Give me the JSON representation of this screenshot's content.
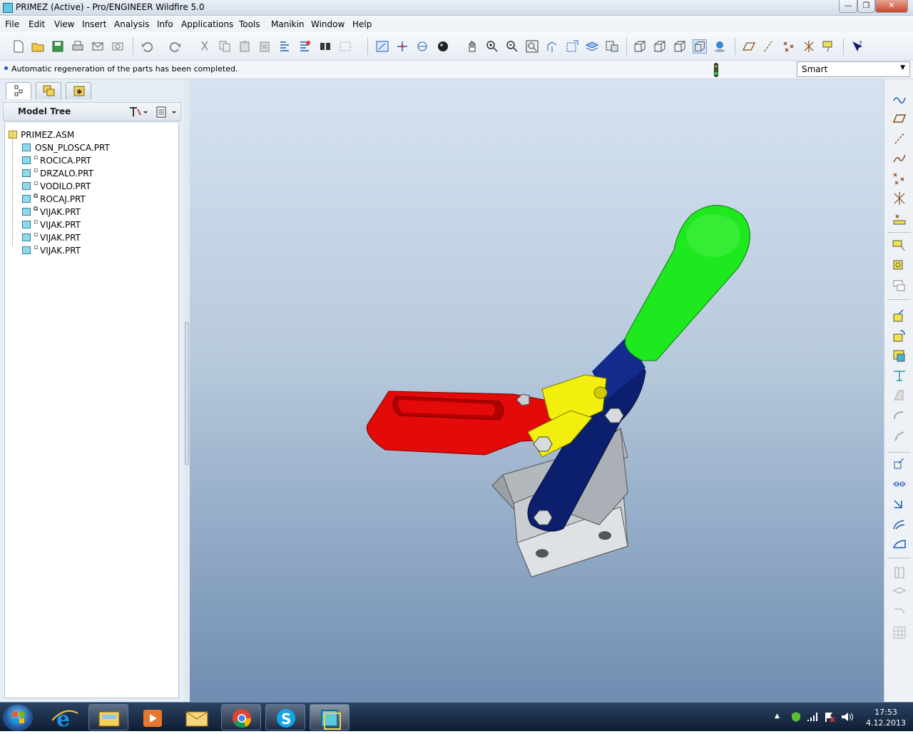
{
  "window": {
    "title": "PRIMEZ (Active) - Pro/ENGINEER Wildfire 5.0",
    "min_glyph": "—",
    "max_glyph": "❐",
    "close_glyph": "✕"
  },
  "menu": [
    {
      "label": "File"
    },
    {
      "label": "Edit"
    },
    {
      "label": "View"
    },
    {
      "label": "Insert"
    },
    {
      "label": "Analysis"
    },
    {
      "label": "Info"
    },
    {
      "label": "Applications"
    },
    {
      "label": "Tools"
    },
    {
      "label": "Manikin"
    },
    {
      "label": "Window"
    },
    {
      "label": "Help"
    }
  ],
  "toolbar": {
    "icons": [
      "new-file-icon",
      "open-file-icon",
      "save-icon",
      "print-icon",
      "email-icon",
      "email-link-icon",
      "undo-icon",
      "redo-icon",
      "cut-icon",
      "copy-icon",
      "paste-icon",
      "paste-special-icon",
      "regenerate-icon",
      "regen-manager-icon",
      "find-icon",
      "select-box-icon",
      "repaint-icon",
      "spin-center-icon",
      "orient-mode-icon",
      "shading-icon",
      "pan-icon",
      "zoom-in-icon",
      "zoom-out-icon",
      "refit-icon",
      "reorient-icon",
      "saved-views-icon",
      "layers-icon",
      "view-manager-icon",
      "wireframe-icon",
      "hidden-line-icon",
      "no-hidden-icon",
      "shaded-icon",
      "enhanced-realism-icon",
      "datum-plane-display-icon",
      "datum-axis-display-icon",
      "datum-point-display-icon",
      "csys-display-icon",
      "annotation-display-icon",
      "context-help-icon"
    ]
  },
  "status": {
    "message": "Automatic regeneration of the parts has been completed.",
    "filter": "Smart"
  },
  "navigator": {
    "tabs": [
      "model-tree-tab",
      "folder-browser-tab",
      "favorites-tab"
    ],
    "header": "Model Tree",
    "tree": [
      {
        "name": "PRIMEZ.ASM",
        "type": "asm",
        "flag": ""
      },
      {
        "name": "OSN_PLOSCA.PRT",
        "type": "prt",
        "flag": ""
      },
      {
        "name": "ROCICA.PRT",
        "type": "prt",
        "flag": "▫"
      },
      {
        "name": "DRZALO.PRT",
        "type": "prt",
        "flag": "▫"
      },
      {
        "name": "VODILO.PRT",
        "type": "prt",
        "flag": "▫"
      },
      {
        "name": "ROCAJ.PRT",
        "type": "prt",
        "flag": "⧉"
      },
      {
        "name": "VIJAK.PRT",
        "type": "prt",
        "flag": "⧉"
      },
      {
        "name": "VIJAK.PRT",
        "type": "prt",
        "flag": "▫"
      },
      {
        "name": "VIJAK.PRT",
        "type": "prt",
        "flag": "▫"
      },
      {
        "name": "VIJAK.PRT",
        "type": "prt",
        "flag": "▫"
      }
    ]
  },
  "model_colors": {
    "handle_grip": "#1ee81e",
    "lever": "#0b1f6e",
    "link": "#f2ee0e",
    "clamp_arm": "#e40a0a",
    "base": "#c9cdd2"
  },
  "right_toolbar": {
    "icons": [
      "sketch-icon",
      "datum-plane-icon",
      "datum-axis-icon",
      "datum-curve-icon",
      "datum-point-icon",
      "datum-point-offset-icon",
      "datum-csys-icon",
      "extrude-icon",
      "revolve-icon",
      "variable-section-sweep-icon",
      "boundary-blend-icon",
      "style-icon",
      "hole-icon",
      "shell-icon",
      "rib-icon",
      "draft-icon",
      "round-icon",
      "chamfer-icon",
      "pattern-icon",
      "mirror-icon",
      "merge-icon",
      "trim-icon",
      "offset-icon",
      "thicken-icon",
      "solidify-icon",
      "project-icon",
      "intersect-icon",
      "wrap-icon"
    ]
  },
  "taskbar": {
    "apps": [
      "internet-explorer-icon",
      "file-explorer-icon",
      "media-player-icon",
      "outlook-icon",
      "chrome-icon",
      "skype-icon",
      "proengineer-icon"
    ],
    "time": "17:53",
    "date": "4.12.2013"
  }
}
